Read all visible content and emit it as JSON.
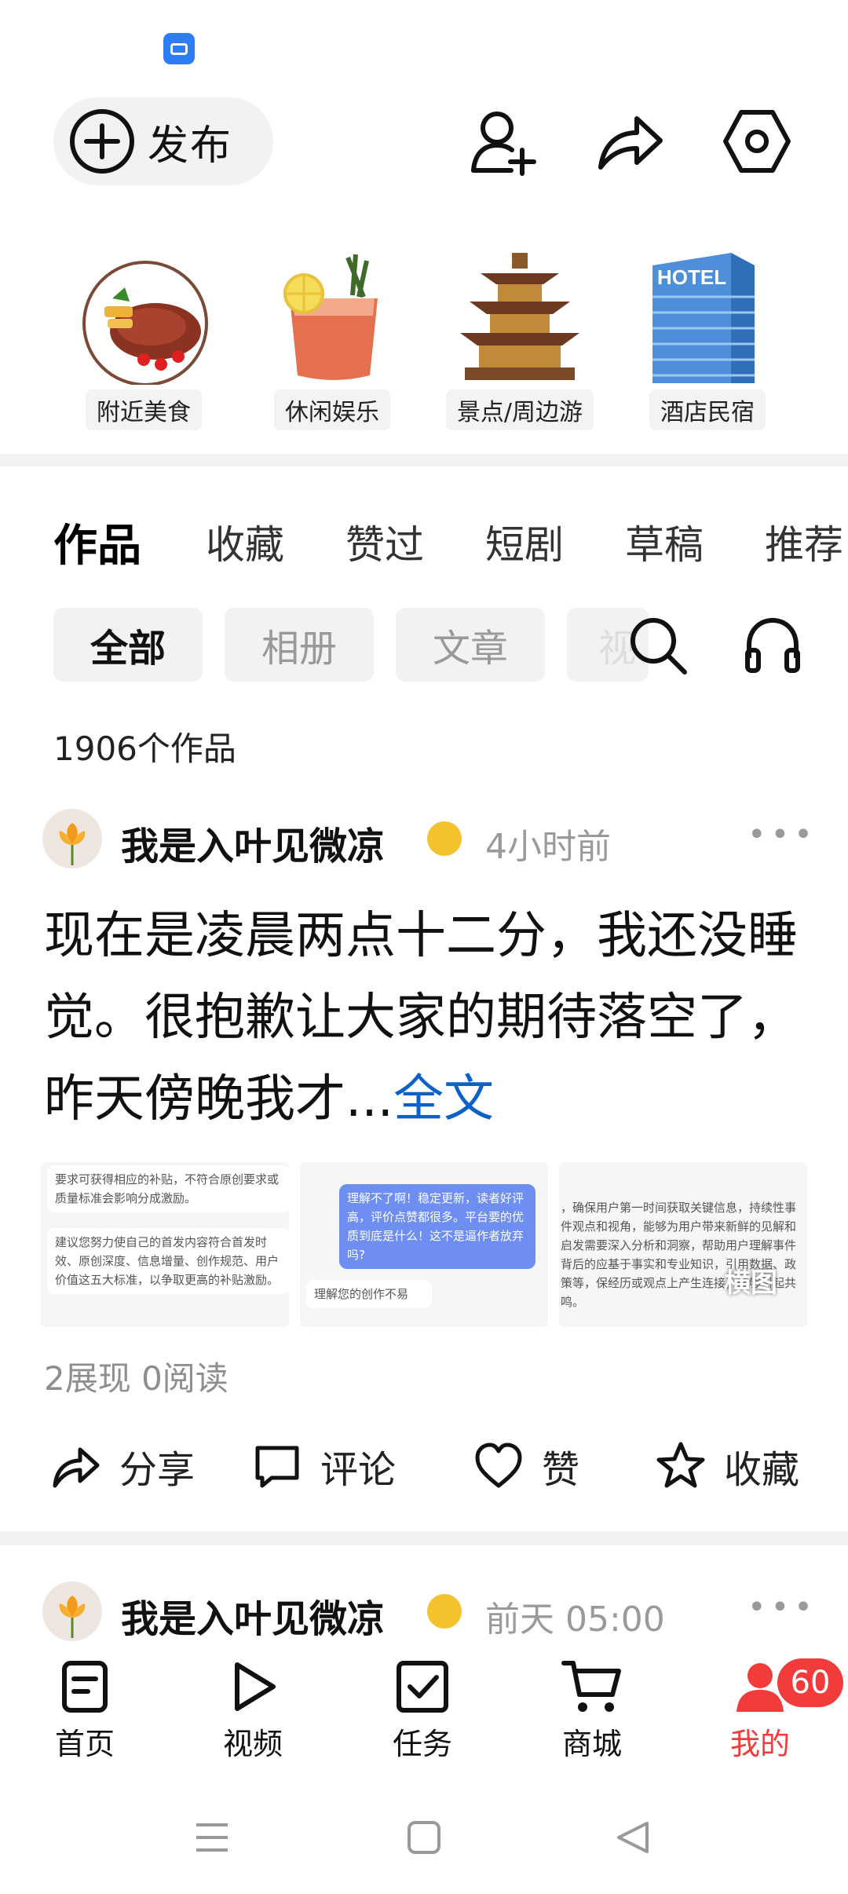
{
  "top_bar": {
    "publish_label": "发布",
    "icons": [
      "add-friend-icon",
      "share-icon",
      "settings-icon"
    ]
  },
  "categories": [
    {
      "label": "附近美食",
      "icon": "food-plate-icon"
    },
    {
      "label": "休闲娱乐",
      "icon": "cocktail-icon"
    },
    {
      "label": "景点/周边游",
      "icon": "pagoda-icon"
    },
    {
      "label": "酒店民宿",
      "icon": "hotel-building-icon"
    }
  ],
  "tabs": [
    "作品",
    "收藏",
    "赞过",
    "短剧",
    "草稿",
    "推荐"
  ],
  "filters": [
    "全部",
    "相册",
    "文章",
    "视"
  ],
  "works_count": "1906个作品",
  "post": {
    "author": "我是入叶见微凉",
    "time": "4小时前",
    "text": "现在是凌晨两点十二分，我还没睡觉。很抱歉让大家的期待落空了，昨天傍晚我才...",
    "more_link": "全文",
    "images": {
      "left_1": "要求可获得相应的补贴，不符合原创要求或质量标准会影响分成激励。",
      "left_2": "建议您努力使自己的首发内容符合首发时效、原创深度、信息增量、创作规范、用户价值这五大标准，以争取更高的补贴激励。",
      "middle_1": "理解不了啊！稳定更新，读者好评高，评价点赞都很多。平台要的优质到底是什么！这不是逼作者放弃吗?",
      "middle_2": "理解您的创作不易",
      "right_1": "，确保用户第一时间获取关键信息，持续性事件观点和视角，能够为用户带来新鲜的见解和启发需要深入分析和洞察，帮助用户理解事件背后的应基于事实和专业知识，引用数据、政策等，保经历或观点上产生连接，能够引起共鸣。",
      "right_watermark": "横图"
    },
    "stats": "2展现  0阅读",
    "actions": [
      "分享",
      "评论",
      "赞",
      "收藏"
    ]
  },
  "post2": {
    "author": "我是入叶见微凉",
    "time": "前天  05:00"
  },
  "bottom_nav": {
    "items": [
      "首页",
      "视频",
      "任务",
      "商城",
      "我的"
    ],
    "badge": "60",
    "accent": "#f23c3c"
  }
}
